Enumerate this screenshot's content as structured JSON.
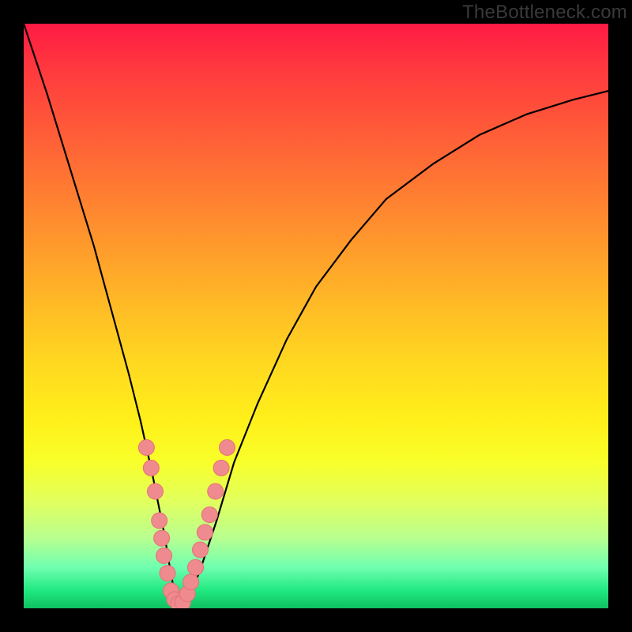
{
  "watermark": "TheBottleneck.com",
  "colors": {
    "frame": "#000000",
    "curve": "#000000",
    "dot_fill": "#ef8a8f",
    "dot_stroke": "#e57076"
  },
  "chart_data": {
    "type": "line",
    "title": "",
    "xlabel": "",
    "ylabel": "",
    "xlim": [
      0,
      100
    ],
    "ylim": [
      0,
      100
    ],
    "legend": false,
    "grid": false,
    "annotations": [],
    "series": [
      {
        "name": "bottleneck-curve",
        "x": [
          0,
          4,
          8,
          12,
          15,
          18,
          20,
          22,
          24,
          25,
          26,
          27,
          28,
          30,
          33,
          36,
          40,
          45,
          50,
          56,
          62,
          70,
          78,
          86,
          94,
          100
        ],
        "y": [
          100,
          88,
          75,
          62,
          51,
          40,
          32,
          23,
          13,
          7,
          1.5,
          0.5,
          1.5,
          6,
          15,
          25,
          35,
          46,
          55,
          63,
          70,
          76,
          81,
          84.5,
          87,
          88.5
        ]
      }
    ],
    "scatter": {
      "name": "highlighted-points",
      "points": [
        {
          "x": 21.0,
          "y": 27.5
        },
        {
          "x": 21.8,
          "y": 24.0
        },
        {
          "x": 22.5,
          "y": 20.0
        },
        {
          "x": 23.2,
          "y": 15.0
        },
        {
          "x": 23.6,
          "y": 12.0
        },
        {
          "x": 24.0,
          "y": 9.0
        },
        {
          "x": 24.6,
          "y": 6.0
        },
        {
          "x": 25.2,
          "y": 3.0
        },
        {
          "x": 25.8,
          "y": 1.5
        },
        {
          "x": 26.5,
          "y": 0.8
        },
        {
          "x": 27.2,
          "y": 1.0
        },
        {
          "x": 28.0,
          "y": 2.5
        },
        {
          "x": 28.6,
          "y": 4.5
        },
        {
          "x": 29.4,
          "y": 7.0
        },
        {
          "x": 30.2,
          "y": 10.0
        },
        {
          "x": 31.0,
          "y": 13.0
        },
        {
          "x": 31.8,
          "y": 16.0
        },
        {
          "x": 32.8,
          "y": 20.0
        },
        {
          "x": 33.8,
          "y": 24.0
        },
        {
          "x": 34.8,
          "y": 27.5
        }
      ]
    }
  }
}
